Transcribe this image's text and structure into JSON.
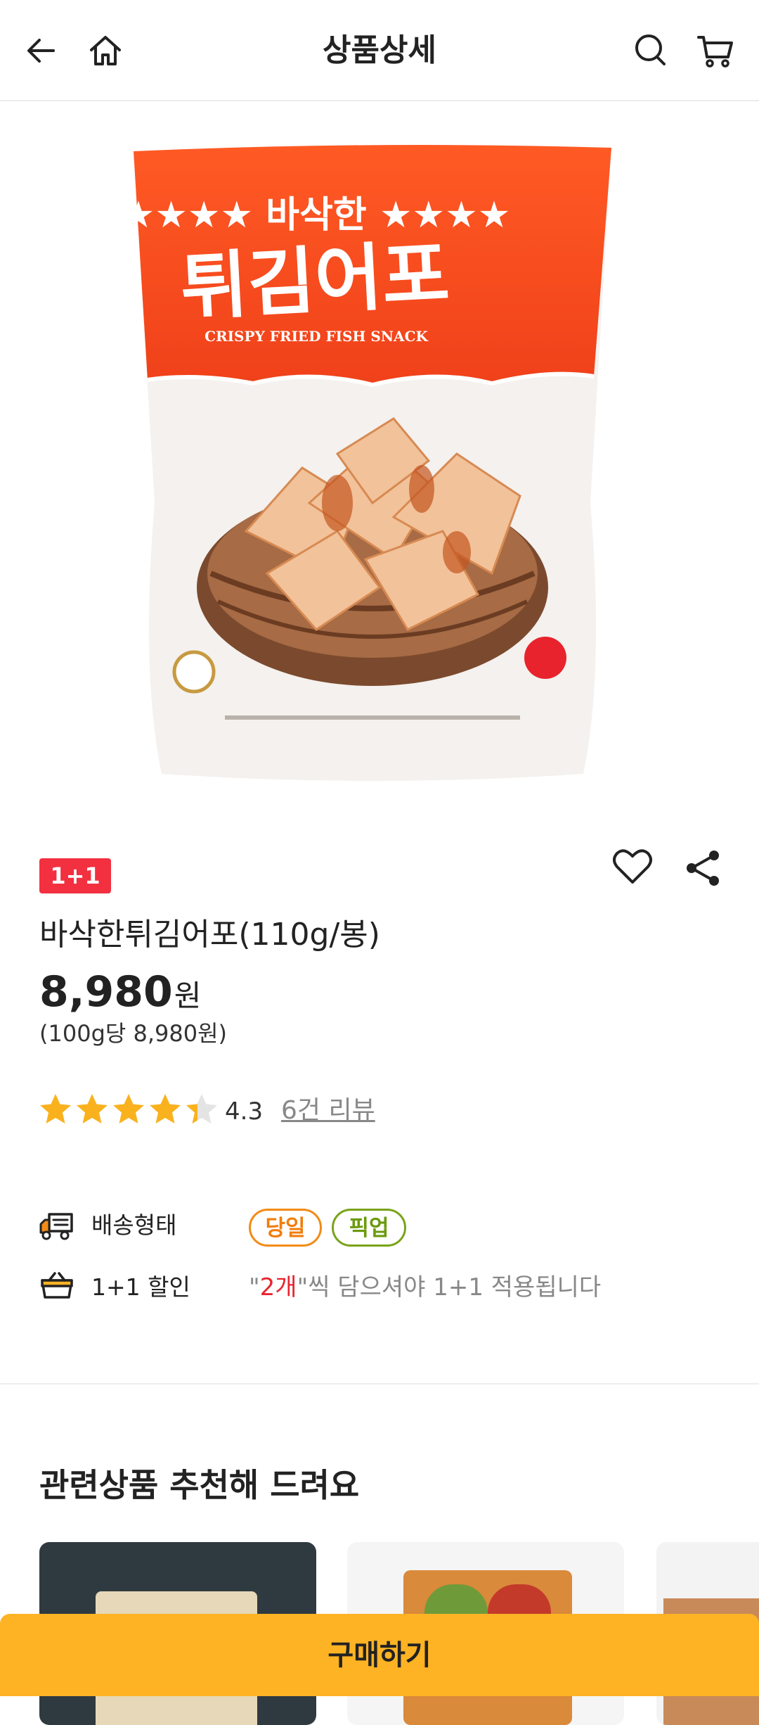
{
  "header": {
    "title": "상품상세",
    "icons": [
      "back-arrow-icon",
      "home-icon",
      "search-icon",
      "cart-icon"
    ]
  },
  "product": {
    "image_label": "바삭한 튀김어포",
    "badge": "1+1",
    "name": "바삭한튀김어포(110g/봉)",
    "price": "8,980",
    "price_unit": "원",
    "unit_price": "(100g당 8,980원)",
    "rating": {
      "stars": 4.3,
      "score": "4.3",
      "review_link": "6건 리뷰"
    }
  },
  "delivery": {
    "label": "배송형태",
    "chips": [
      "당일",
      "픽업"
    ]
  },
  "promo": {
    "label": "1+1 할인",
    "text_prefix": "\"",
    "text_highlight": "2개",
    "text_suffix": "\"씩 담으셔야 1+1 적용됩니다"
  },
  "related": {
    "title": "관련상품 추천해 드려요"
  },
  "buy_button": "구매하기",
  "colors": {
    "accent": "#fdb324",
    "badge": "#f23040",
    "chip_same_day": "#f27d0c",
    "chip_pickup": "#6a9a0c",
    "star": "#f9b21e"
  }
}
